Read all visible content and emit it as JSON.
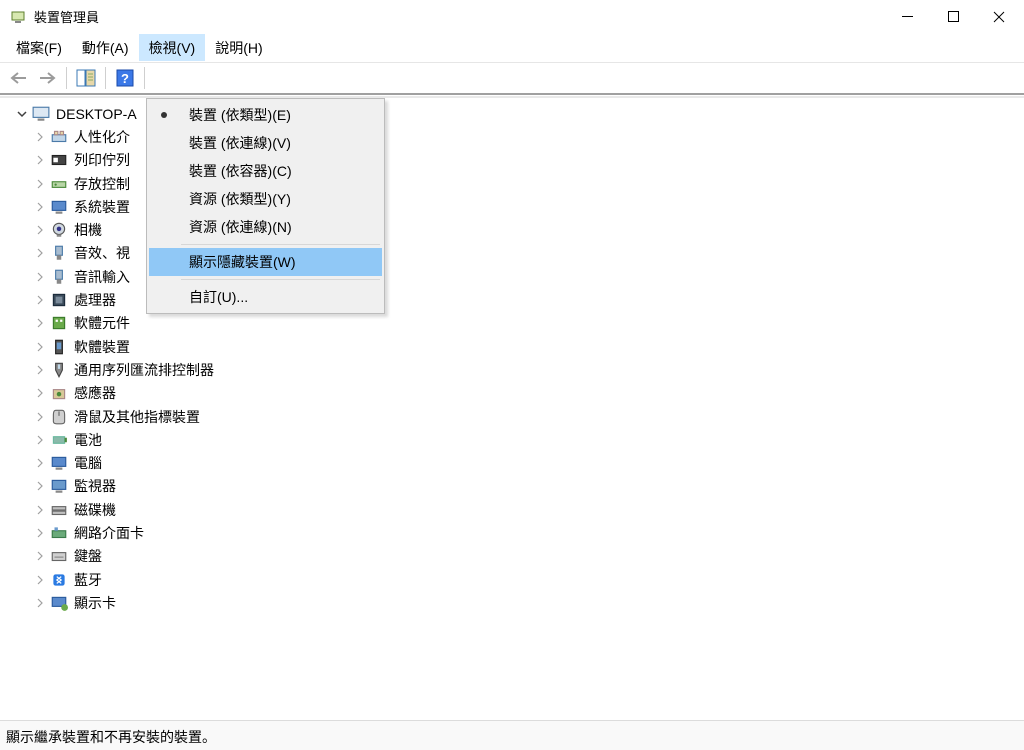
{
  "titlebar": {
    "title": "裝置管理員"
  },
  "menubar": {
    "file": "檔案(F)",
    "action": "動作(A)",
    "view": "檢視(V)",
    "help": "說明(H)"
  },
  "view_menu": {
    "by_type": "裝置 (依類型)(E)",
    "by_connection": "裝置 (依連線)(V)",
    "by_container": "裝置 (依容器)(C)",
    "res_by_type": "資源 (依類型)(Y)",
    "res_by_conn": "資源 (依連線)(N)",
    "show_hidden": "顯示隱藏裝置(W)",
    "customize": "自訂(U)..."
  },
  "tree": {
    "root": "DESKTOP-A",
    "items": [
      "人性化介",
      "列印佇列",
      "存放控制",
      "系統裝置",
      "相機",
      "音效、視",
      "音訊輸入",
      "處理器",
      "軟體元件",
      "軟體裝置",
      "通用序列匯流排控制器",
      "感應器",
      "滑鼠及其他指標裝置",
      "電池",
      "電腦",
      "監視器",
      "磁碟機",
      "網路介面卡",
      "鍵盤",
      "藍牙",
      "顯示卡"
    ]
  },
  "statusbar": {
    "text": "顯示繼承裝置和不再安裝的裝置。"
  }
}
